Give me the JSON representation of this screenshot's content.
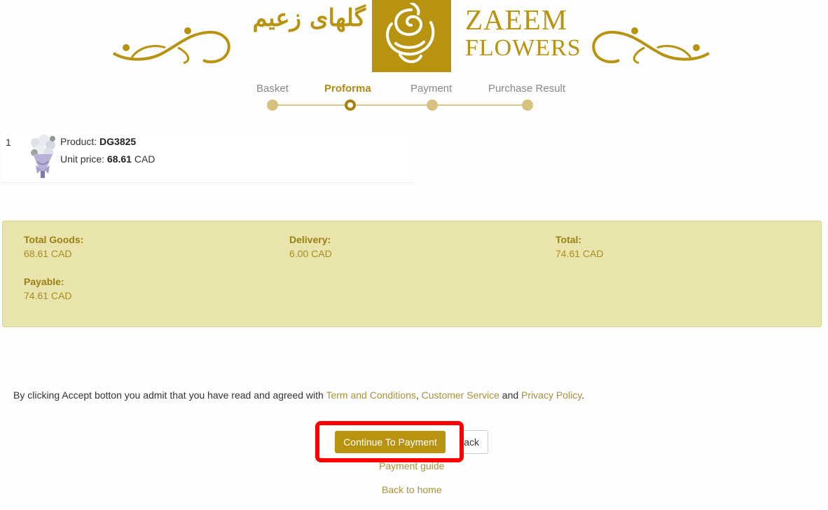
{
  "header": {
    "brand_fa": "گلهای زعیم",
    "brand_en_line1": "ZAEEM",
    "brand_en_line2": "FLOWERS",
    "brand_color": "#b8930f",
    "logo_icon": "rose-icon"
  },
  "steps": [
    {
      "label": "Basket",
      "active": false
    },
    {
      "label": "Proforma",
      "active": true
    },
    {
      "label": "Payment",
      "active": false
    },
    {
      "label": "Purchase Result",
      "active": false
    }
  ],
  "product": {
    "row_number": "1",
    "product_label": "Product: ",
    "product_code": "DG3825",
    "price_label": "Unit price: ",
    "price_value": "68.61",
    "currency": " CAD",
    "thumbnail_icon": "bouquet-icon"
  },
  "summary": {
    "total_goods_label": "Total Goods:",
    "total_goods_value": "68.61 CAD",
    "delivery_label": "Delivery:",
    "delivery_value": "6.00 CAD",
    "total_label": "Total:",
    "total_value": "74.61 CAD",
    "payable_label": "Payable:",
    "payable_value": "74.61 CAD",
    "background_color": "#e9e4ab"
  },
  "agreement": {
    "text_before": "By clicking Accept botton you admit that you have read and agreed with ",
    "terms_link": "Term and Conditions",
    "comma": ", ",
    "service_link": "Customer Service",
    "and_text": " and ",
    "privacy_link": "Privacy Policy",
    "period": "."
  },
  "actions": {
    "continue_label": "Continue To Payment",
    "back_label": "ack",
    "payment_guide_label": "Payment guide",
    "back_home_label": "Back to home",
    "highlight_color": "#ff0000"
  }
}
